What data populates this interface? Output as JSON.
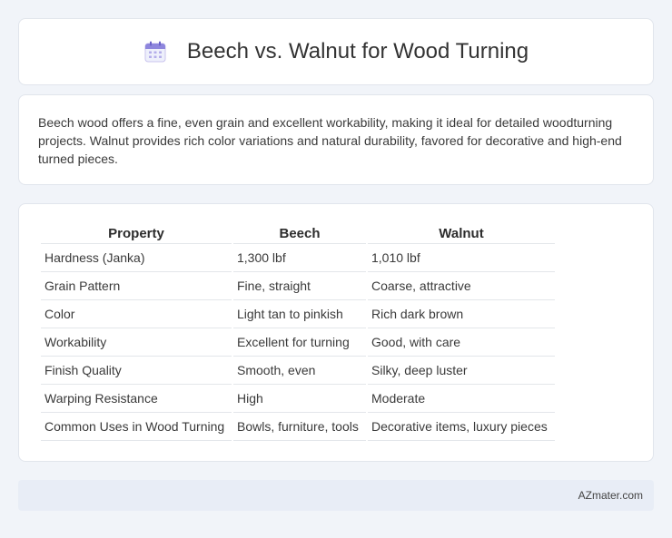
{
  "header": {
    "title": "Beech vs. Walnut for Wood Turning",
    "icon": "calendar-icon"
  },
  "summary": {
    "text": "Beech wood offers a fine, even grain and excellent workability, making it ideal for detailed woodturning projects. Walnut provides rich color variations and natural durability, favored for decorative and high-end turned pieces."
  },
  "table": {
    "headers": [
      "Property",
      "Beech",
      "Walnut"
    ],
    "rows": [
      [
        "Hardness (Janka)",
        "1,300 lbf",
        "1,010 lbf"
      ],
      [
        "Grain Pattern",
        "Fine, straight",
        "Coarse, attractive"
      ],
      [
        "Color",
        "Light tan to pinkish",
        "Rich dark brown"
      ],
      [
        "Workability",
        "Excellent for turning",
        "Good, with care"
      ],
      [
        "Finish Quality",
        "Smooth, even",
        "Silky, deep luster"
      ],
      [
        "Warping Resistance",
        "High",
        "Moderate"
      ],
      [
        "Common Uses in Wood Turning",
        "Bowls, furniture, tools",
        "Decorative items, luxury pieces"
      ]
    ]
  },
  "footer": {
    "text": "AZmater.com"
  }
}
